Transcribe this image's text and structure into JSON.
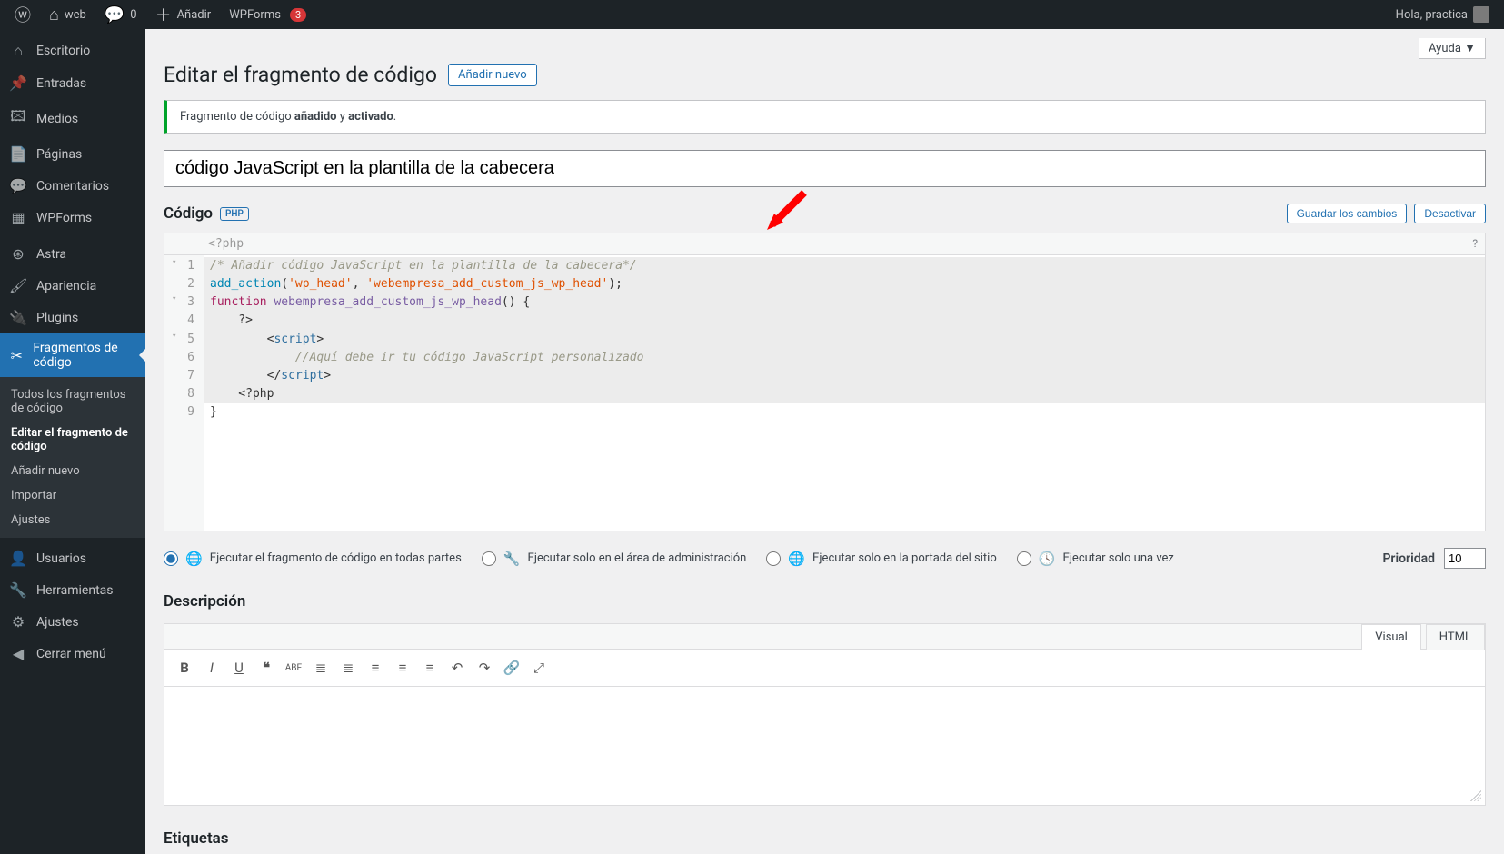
{
  "adminbar": {
    "site": "web",
    "comments": "0",
    "add": "Añadir",
    "wpforms": "WPForms",
    "wpforms_count": "3",
    "greeting": "Hola, practica"
  },
  "sidebar": {
    "items": [
      {
        "icon": "⌂",
        "label": "Escritorio"
      },
      {
        "icon": "📌",
        "label": "Entradas"
      },
      {
        "icon": "🖾",
        "label": "Medios"
      },
      {
        "icon": "📄",
        "label": "Páginas"
      },
      {
        "icon": "💬",
        "label": "Comentarios"
      },
      {
        "icon": "▦",
        "label": "WPForms"
      },
      {
        "sep": true
      },
      {
        "icon": "⊛",
        "label": "Astra"
      },
      {
        "icon": "🖌",
        "label": "Apariencia"
      },
      {
        "icon": "🔌",
        "label": "Plugins"
      },
      {
        "icon": "✂",
        "label": "Fragmentos de código",
        "current": true
      },
      {
        "sub": [
          {
            "label": "Todos los fragmentos de código"
          },
          {
            "label": "Editar el fragmento de código",
            "current": true
          },
          {
            "label": "Añadir nuevo"
          },
          {
            "label": "Importar"
          },
          {
            "label": "Ajustes"
          }
        ]
      },
      {
        "sep": true
      },
      {
        "icon": "👤",
        "label": "Usuarios"
      },
      {
        "icon": "🔧",
        "label": "Herramientas"
      },
      {
        "icon": "⚙",
        "label": "Ajustes"
      },
      {
        "icon": "◀",
        "label": "Cerrar menú"
      }
    ]
  },
  "help": "Ayuda ▼",
  "page_heading": "Editar el fragmento de código",
  "add_new": "Añadir nuevo",
  "notice": {
    "pre": "Fragmento de código ",
    "b1": "añadido",
    "mid": " y ",
    "b2": "activado",
    "post": "."
  },
  "snippet_title": "código JavaScript en la plantilla de la cabecera",
  "code_block": {
    "heading": "Código",
    "tag": "PHP",
    "save": "Guardar los cambios",
    "deactivate": "Desactivar",
    "prefix": "<?php",
    "lines": [
      {
        "n": 1,
        "fold": true,
        "hl": true,
        "html": "<span class='c-com'>/* Añadir código JavaScript en la plantilla de la cabecera*/</span>"
      },
      {
        "n": 2,
        "fold": false,
        "hl": true,
        "html": "<span class='c-func'>add_action</span><span class='c-plain'>(</span><span class='c-str'>'wp_head'</span><span class='c-plain'>, </span><span class='c-str'>'webempresa_add_custom_js_wp_head'</span><span class='c-plain'>);</span>"
      },
      {
        "n": 3,
        "fold": true,
        "hl": true,
        "html": "<span class='c-kw'>function</span> <span class='c-def'>webempresa_add_custom_js_wp_head</span><span class='c-plain'>() {</span>"
      },
      {
        "n": 4,
        "fold": false,
        "hl": true,
        "html": "<span class='c-plain'>    ?&gt;</span>"
      },
      {
        "n": 5,
        "fold": true,
        "hl": true,
        "html": "        <span class='c-plain'>&lt;</span><span class='c-tag'>script</span><span class='c-plain'>&gt;</span>"
      },
      {
        "n": 6,
        "fold": false,
        "hl": true,
        "html": "            <span class='c-com'>//Aquí debe ir tu código JavaScript personalizado</span>"
      },
      {
        "n": 7,
        "fold": false,
        "hl": true,
        "html": "        <span class='c-plain'>&lt;/</span><span class='c-tag'>script</span><span class='c-plain'>&gt;</span>"
      },
      {
        "n": 8,
        "fold": false,
        "hl": true,
        "html": "<span class='c-plain'>    &lt;?php</span>"
      },
      {
        "n": 9,
        "fold": false,
        "hl": false,
        "html": "<span class='c-plain'>}</span>"
      }
    ]
  },
  "run_options": {
    "o1": {
      "label": "Ejecutar el fragmento de código en todas partes",
      "icon": "🌐",
      "checked": true
    },
    "o2": {
      "label": "Ejecutar solo en el área de administración",
      "icon": "🔧"
    },
    "o3": {
      "label": "Ejecutar solo en la portada del sitio",
      "icon": "🌐"
    },
    "o4": {
      "label": "Ejecutar solo una vez",
      "icon": "🕓"
    }
  },
  "priority_label": "Prioridad",
  "priority_value": "10",
  "description_heading": "Descripción",
  "desc_tabs": {
    "visual": "Visual",
    "html": "HTML"
  },
  "tags_heading": "Etiquetas"
}
